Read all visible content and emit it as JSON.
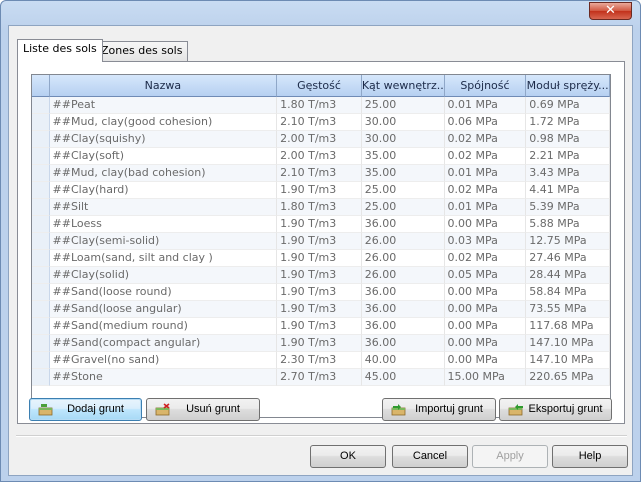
{
  "window": {
    "close_glyph": "✕"
  },
  "tabs": [
    {
      "label": "Liste des sols"
    },
    {
      "label": "Zones des sols"
    }
  ],
  "table": {
    "columns": [
      "Nazwa",
      "Gęstość",
      "Kąt wewnętrz...",
      "Spójność",
      "Moduł spręży..."
    ],
    "rows": [
      [
        "##Peat",
        "1.80 T/m3",
        "25.00",
        "0.01 MPa",
        "0.69 MPa"
      ],
      [
        "##Mud, clay(good cohesion)",
        "2.10 T/m3",
        "30.00",
        "0.06 MPa",
        "1.72 MPa"
      ],
      [
        "##Clay(squishy)",
        "2.00 T/m3",
        "30.00",
        "0.02 MPa",
        "0.98 MPa"
      ],
      [
        "##Clay(soft)",
        "2.00 T/m3",
        "35.00",
        "0.02 MPa",
        "2.21 MPa"
      ],
      [
        "##Mud, clay(bad cohesion)",
        "2.10 T/m3",
        "35.00",
        "0.01 MPa",
        "3.43 MPa"
      ],
      [
        "##Clay(hard)",
        "1.90 T/m3",
        "25.00",
        "0.02 MPa",
        "4.41 MPa"
      ],
      [
        "##Silt",
        "1.80 T/m3",
        "25.00",
        "0.01 MPa",
        "5.39 MPa"
      ],
      [
        "##Loess",
        "1.90 T/m3",
        "36.00",
        "0.00 MPa",
        "5.88 MPa"
      ],
      [
        "##Clay(semi-solid)",
        "1.90 T/m3",
        "26.00",
        "0.03 MPa",
        "12.75 MPa"
      ],
      [
        "##Loam(sand, silt and clay )",
        "1.90 T/m3",
        "26.00",
        "0.02 MPa",
        "27.46 MPa"
      ],
      [
        "##Clay(solid)",
        "1.90 T/m3",
        "26.00",
        "0.05 MPa",
        "28.44 MPa"
      ],
      [
        "##Sand(loose round)",
        "1.90 T/m3",
        "36.00",
        "0.00 MPa",
        "58.84 MPa"
      ],
      [
        "##Sand(loose angular)",
        "1.90 T/m3",
        "36.00",
        "0.00 MPa",
        "73.55 MPa"
      ],
      [
        "##Sand(medium round)",
        "1.90 T/m3",
        "36.00",
        "0.00 MPa",
        "117.68 MPa"
      ],
      [
        "##Sand(compact angular)",
        "1.90 T/m3",
        "36.00",
        "0.00 MPa",
        "147.10 MPa"
      ],
      [
        "##Gravel(no sand)",
        "2.30 T/m3",
        "40.00",
        "0.00 MPa",
        "147.10 MPa"
      ],
      [
        "##Stone",
        "2.70 T/m3",
        "45.00",
        "15.00 MPa",
        "220.65 MPa"
      ]
    ]
  },
  "actions": {
    "add": "Dodaj grunt",
    "remove": "Usuń grunt",
    "import": "Importuj grunt",
    "export": "Eksportuj grunt"
  },
  "dialog": {
    "ok": "OK",
    "cancel": "Cancel",
    "apply": "Apply",
    "help": "Help"
  },
  "icons": {
    "add": "add-soil-icon",
    "remove": "remove-soil-icon",
    "import": "import-soil-icon",
    "export": "export-soil-icon"
  },
  "colors": {
    "accent": "#3c7fb1",
    "header": "#b6d0f1",
    "close": "#c2311b"
  }
}
